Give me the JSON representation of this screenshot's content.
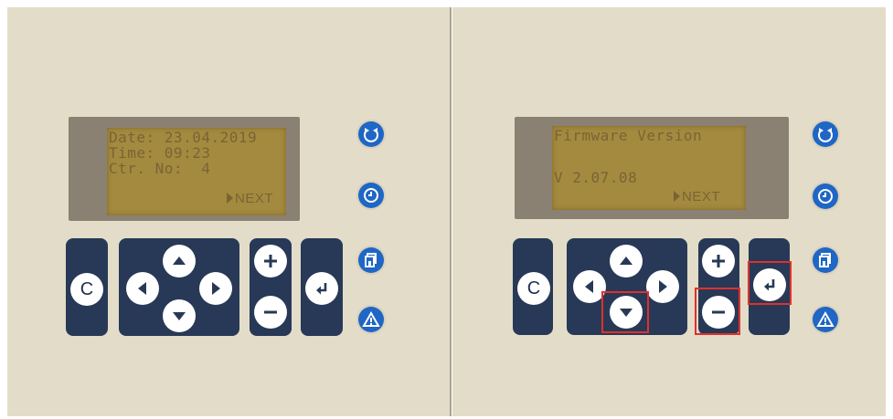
{
  "left_panel": {
    "lcd_lines": [
      "Date: 23.04.2019",
      "Time: 09:23",
      "Ctr. No:  4"
    ],
    "lcd_next": "NEXT"
  },
  "right_panel": {
    "lcd_lines": [
      "Firmware Version",
      "",
      "V 2.07.08"
    ],
    "lcd_next": "NEXT"
  },
  "keys": {
    "clear": "C",
    "up": "arrow-up-icon",
    "down": "arrow-down-icon",
    "left": "arrow-left-icon",
    "right": "arrow-right-icon",
    "plus": "plus-icon",
    "minus": "minus-icon",
    "enter": "enter-icon"
  },
  "side_buttons": [
    "reset-icon",
    "clock-icon",
    "save-icon",
    "warning-icon"
  ],
  "colors": {
    "panel_bg": "#e3dcc8",
    "keypad": "#273957",
    "lcd": "#a48a3f",
    "lcd_text": "#7a6335",
    "side_button": "#1f66c5",
    "highlight": "#e0302b"
  },
  "highlighted_keys": [
    "down",
    "minus",
    "enter"
  ]
}
